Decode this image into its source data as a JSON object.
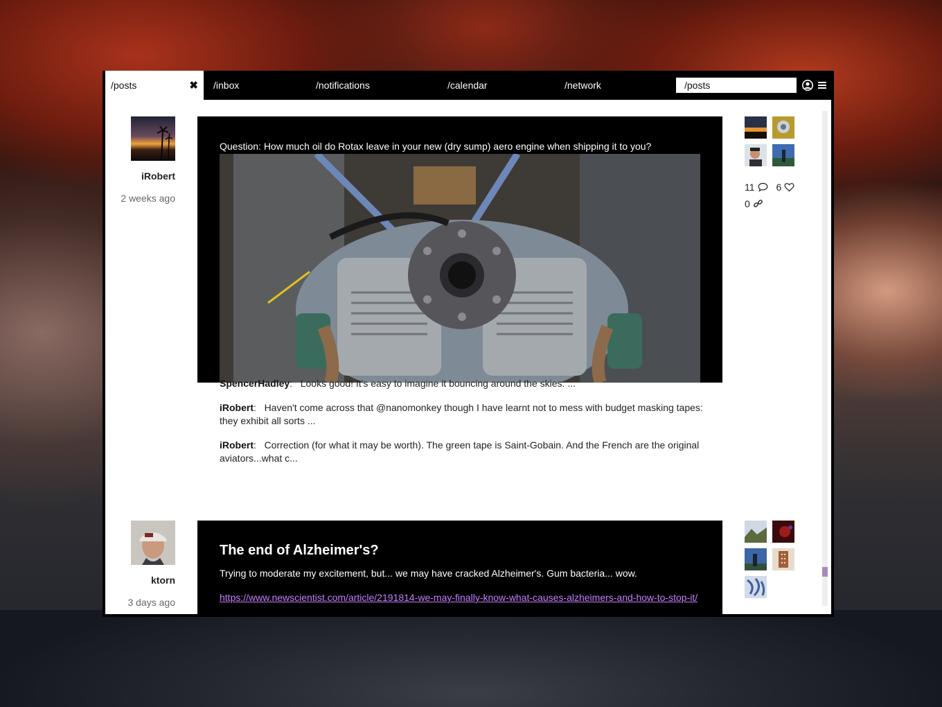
{
  "tabs": {
    "active": "/posts",
    "items": [
      "/inbox",
      "/notifications",
      "/calendar",
      "/network"
    ]
  },
  "search": {
    "value": "/posts"
  },
  "icons": {
    "close": "close-icon",
    "account": "user-circle-icon",
    "menu": "hamburger-menu-icon",
    "comment": "speech-bubble-icon",
    "like": "heart-icon",
    "share": "link-icon"
  },
  "posts": [
    {
      "author": "iRobert",
      "time": "2 weeks ago",
      "question": "Question: How much oil do Rotax leave in your new (dry sump) aero engine when shipping it to you?",
      "stats": {
        "comments": "11",
        "likes": "6",
        "shares": "0"
      },
      "comments": [
        {
          "user": "SpencerHadley",
          "text": "Looks good! It's easy to imagine it bouncing around the skies. ..."
        },
        {
          "user": "iRobert",
          "text": "Haven't come across that @nanomonkey though I have learnt not to mess with budget masking tapes: they exhibit all sorts ..."
        },
        {
          "user": "iRobert",
          "text": "Correction (for what it may be worth). The green tape is Saint-Gobain. And the French are the original aviators...what c..."
        }
      ]
    },
    {
      "author": "ktorn",
      "time": "3 days ago",
      "title": "The end of Alzheimer's?",
      "text": "Trying to moderate my excitement, but... we may have cracked Alzheimer's. Gum bacteria... wow.",
      "link": "https://www.newscientist.com/article/2191814-we-may-finally-know-what-causes-alzheimers-and-how-to-stop-it/"
    }
  ],
  "colors": {
    "accent_link": "#c77dff",
    "scroll_thumb": "#a88ab8"
  }
}
